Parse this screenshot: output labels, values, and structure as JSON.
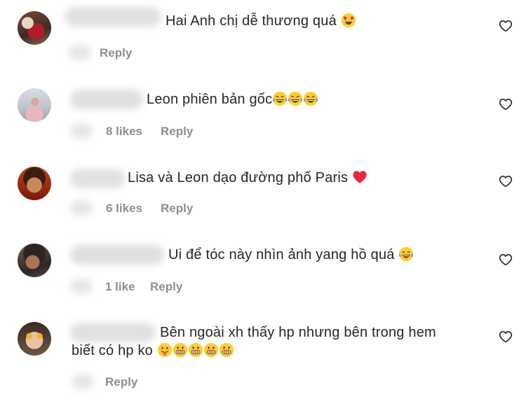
{
  "comments": [
    {
      "text": "Hai Anh chị dễ thương quá",
      "emojis": [
        "heart-eyes"
      ],
      "likes": "",
      "reply": "Reply"
    },
    {
      "text": "Leon phiên bản gốc",
      "emojis": [
        "tears-of-joy",
        "tears-of-joy",
        "tears-of-joy"
      ],
      "likes": "8 likes",
      "reply": "Reply"
    },
    {
      "text": "Lisa và Leon dạo đường phố Paris",
      "emojis": [
        "red-heart"
      ],
      "likes": "6 likes",
      "reply": "Reply"
    },
    {
      "text": "Ui để tóc này nhìn ảnh yang hồ quá",
      "emojis": [
        "tears-of-joy"
      ],
      "likes": "1 like",
      "reply": "Reply"
    },
    {
      "line1": "Bên ngoài xh thấy hp nhưng bên trong hem",
      "line2": "biết có hp ko",
      "emojis": [
        "tongue-out",
        "grimacing",
        "grimacing",
        "grimacing",
        "grimacing"
      ],
      "likes": "",
      "reply": "Reply"
    }
  ],
  "icons": {
    "like": "heart-outline-icon"
  }
}
